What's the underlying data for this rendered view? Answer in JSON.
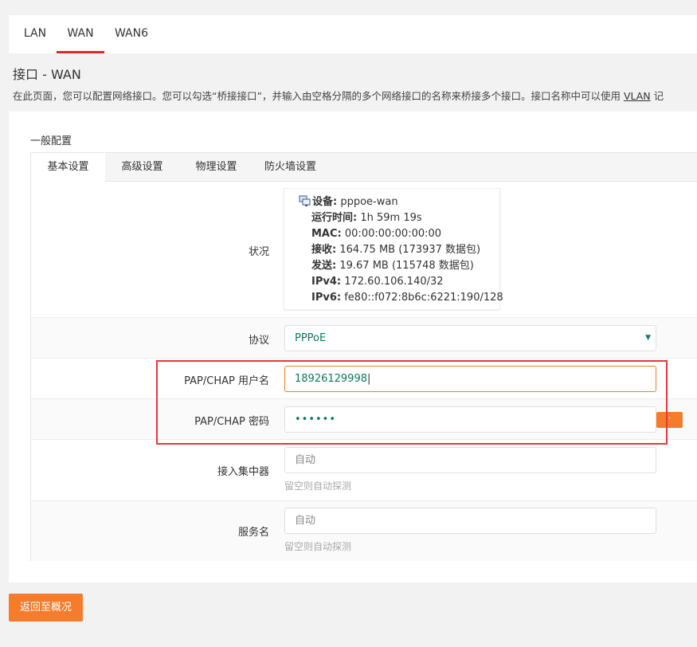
{
  "top_tabs": [
    "LAN",
    "WAN",
    "WAN6"
  ],
  "active_top_tab": "WAN",
  "page_title": "接口 - WAN",
  "page_description": "在此页面，您可以配置网络接口。您可以勾选“桥接接口”，并输入由空格分隔的多个网络接口的名称来桥接多个接口。接口名称中可以使用 ",
  "page_description_link": "VLAN",
  "page_description_tail": " 记",
  "section_title": "一般配置",
  "sub_tabs": [
    "基本设置",
    "高级设置",
    "物理设置",
    "防火墙设置"
  ],
  "status": {
    "label": "状况",
    "device_label": "设备:",
    "device_value": "pppoe-wan",
    "uptime_label": "运行时间:",
    "uptime_value": "1h 59m 19s",
    "mac_label": "MAC:",
    "mac_value": "00:00:00:00:00:00",
    "rx_label": "接收:",
    "rx_value": "164.75 MB (173937 数据包)",
    "tx_label": "发送:",
    "tx_value": "19.67 MB (115748 数据包)",
    "ipv4_label": "IPv4:",
    "ipv4_value": "172.60.106.140/32",
    "ipv6_label": "IPv6:",
    "ipv6_value": "fe80::f072:8b6c:6221:190/128"
  },
  "protocol": {
    "label": "协议",
    "value": "PPPoE",
    "arrow": "▼"
  },
  "username": {
    "label": "PAP/CHAP 用户名",
    "value": "18926129998"
  },
  "password": {
    "label": "PAP/CHAP 密码",
    "value": "••••••"
  },
  "concentrator": {
    "label": "接入集中器",
    "placeholder": "自动",
    "hint": "留空则自动探测"
  },
  "service": {
    "label": "服务名",
    "placeholder": "自动",
    "hint": "留空则自动探测"
  },
  "back_button": "返回至概况",
  "colors": {
    "accent_orange": "#f57c2d",
    "active_tab_red": "#e5232c",
    "highlight_red": "#e5383b",
    "value_green": "#0a7a55"
  }
}
